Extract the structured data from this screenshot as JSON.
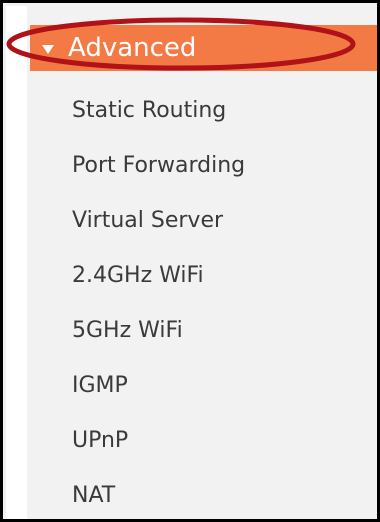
{
  "header": {
    "title": "Advanced",
    "color": "#f47a45"
  },
  "menu": {
    "items": [
      {
        "label": "Static Routing"
      },
      {
        "label": "Port Forwarding"
      },
      {
        "label": "Virtual Server"
      },
      {
        "label": "2.4GHz WiFi"
      },
      {
        "label": "5GHz WiFi"
      },
      {
        "label": "IGMP"
      },
      {
        "label": "UPnP"
      },
      {
        "label": "NAT"
      }
    ]
  },
  "annotation": {
    "highlight_color": "#b01218"
  }
}
